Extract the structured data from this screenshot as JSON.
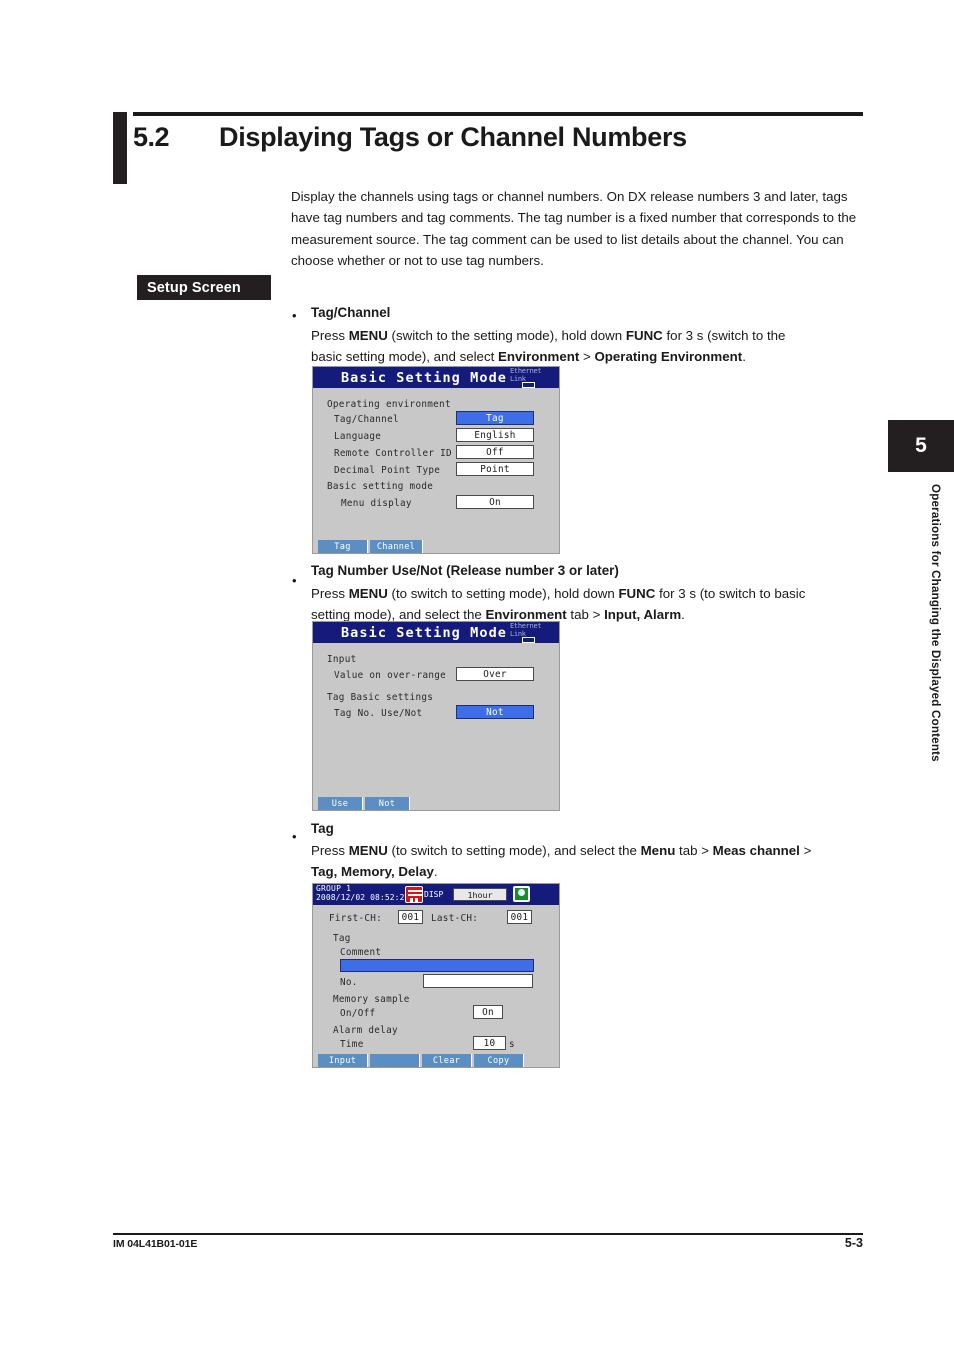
{
  "page": {
    "section_number": "5.2",
    "section_title": "Displaying Tags or Channel Numbers",
    "intro": "Display the channels using tags or channel numbers. On DX release numbers 3 and later, tags have tag numbers and tag comments. The tag number is a fixed number that corresponds to the measurement source. The tag comment can be used to list details about the channel. You can choose whether or not to use tag numbers.",
    "setup_badge": "Setup Screen",
    "bullet_marker": "•"
  },
  "bullets": [
    {
      "heading": "Tag/Channel",
      "line1_a": "Press ",
      "line1_b": "MENU",
      "line1_c": " (switch to the setting mode), hold down ",
      "line1_d": "FUNC",
      "line1_e": " for 3 s (switch to the",
      "line2_a": "basic setting mode), and select ",
      "line2_b": "Environment",
      "line2_c": " > ",
      "line2_d": "Operating Environment",
      "line2_e": "."
    },
    {
      "heading": "Tag Number Use/Not (Release number 3 or later)",
      "line1_a": "Press ",
      "line1_b": "MENU",
      "line1_c": " (to switch to setting mode), hold down ",
      "line1_d": "FUNC",
      "line1_e": " for 3 s (to switch to basic",
      "line2_a": "setting mode), and select the ",
      "line2_b": "Environment",
      "line2_c": " tab > ",
      "line2_d": "Input, Alarm",
      "line2_e": "."
    },
    {
      "heading": "Tag",
      "line1_a": "Press ",
      "line1_b": "MENU",
      "line1_c": " (to switch to setting mode), and select the ",
      "line1_d": "Menu",
      "line1_e": " tab > ",
      "line1_f": "Meas channel",
      "line1_g": " >",
      "line2_a": "Tag, Memory, Delay",
      "line2_e": "."
    }
  ],
  "screen1": {
    "title": "Basic Setting Mode",
    "ethernet_line1": "Ethernet",
    "ethernet_line2": "Link",
    "group_heading": "Operating environment",
    "rows": [
      {
        "label": "Tag/Channel",
        "value": "Tag",
        "selected": true
      },
      {
        "label": "Language",
        "value": "English",
        "selected": false
      },
      {
        "label": "Remote Controller ID",
        "value": "Off",
        "selected": false
      },
      {
        "label": "Decimal Point Type",
        "value": "Point",
        "selected": false
      }
    ],
    "group_heading2": "Basic setting mode",
    "rows2": [
      {
        "label": "Menu display",
        "value": "On",
        "selected": false
      }
    ],
    "keys": [
      "Tag",
      "Channel"
    ]
  },
  "screen2": {
    "title": "Basic Setting Mode",
    "ethernet_line1": "Ethernet",
    "ethernet_line2": "Link",
    "group_heading": "Input",
    "rows": [
      {
        "label": "Value on over-range",
        "value": "Over",
        "selected": false
      }
    ],
    "group_heading2": "Tag Basic settings",
    "rows2": [
      {
        "label": "Tag No. Use/Not",
        "value": "Not",
        "selected": true
      }
    ],
    "keys": [
      "Use",
      "Not"
    ]
  },
  "screen3": {
    "group_label": "GROUP 1",
    "datetime": "2008/12/02 08:52:21",
    "disp_label": "DISP",
    "span_value": "1hour",
    "first_ch_label": "First-CH:",
    "first_ch_value": "001",
    "last_ch_label": "Last-CH:",
    "last_ch_value": "001",
    "tag_heading": "Tag",
    "comment_label": "Comment",
    "comment_value": "",
    "no_label": "No.",
    "no_value": "",
    "memory_heading": "Memory sample",
    "onoff_label": "On/Off",
    "onoff_value": "On",
    "alarm_heading": "Alarm delay",
    "time_label": "Time",
    "time_value": "10",
    "time_unit": "s",
    "keys": [
      "Input",
      "",
      "Clear",
      "Copy"
    ]
  },
  "side": {
    "chapter": "5",
    "chapter_text": "Operations for Changing the Displayed Contents"
  },
  "footer": {
    "manual_code": "IM 04L41B01-01E",
    "page_number": "5-3"
  },
  "colors": {
    "title_bar": "#151b7a",
    "screen_bg": "#c8c8c8",
    "selected_blue": "#3d6ee8",
    "softkey_blue": "#5b8fc4",
    "badge_black": "#231f20"
  }
}
